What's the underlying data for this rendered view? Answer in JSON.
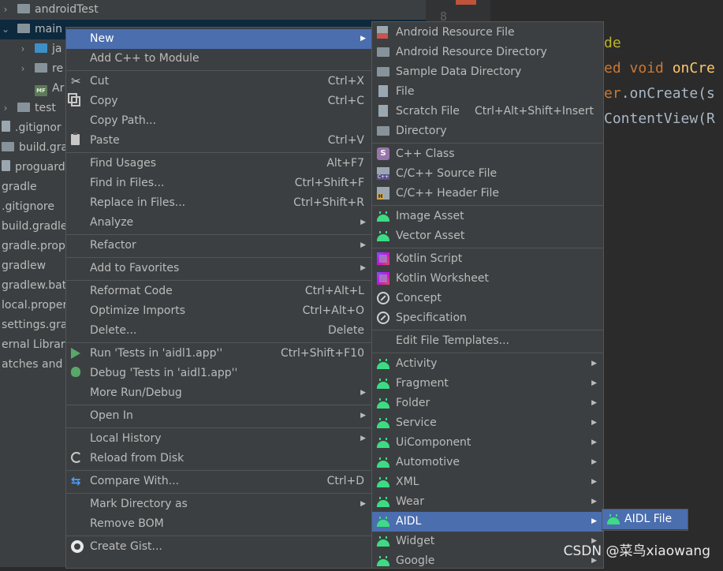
{
  "tree": {
    "items": [
      {
        "label": "androidTest",
        "twisty": "›",
        "icon": "folder-grey",
        "indent": 0
      },
      {
        "label": "main",
        "twisty": "⌄",
        "icon": "folder-grey",
        "indent": 0,
        "selected": true
      },
      {
        "label": "ja",
        "twisty": "›",
        "icon": "folder-blue",
        "indent": 1
      },
      {
        "label": "re",
        "twisty": "›",
        "icon": "folder-grey",
        "indent": 1
      },
      {
        "label": "Ar",
        "twisty": "",
        "icon": "manifest",
        "indent": 1
      },
      {
        "label": "test",
        "twisty": "›",
        "icon": "folder-grey",
        "indent": 0
      },
      {
        "label": ".gitignor",
        "twisty": "",
        "icon": "file",
        "indent": -1
      },
      {
        "label": "build.gra",
        "twisty": "",
        "icon": "gradle",
        "indent": -1
      },
      {
        "label": "proguard",
        "twisty": "",
        "icon": "file",
        "indent": -1
      },
      {
        "label": "gradle",
        "twisty": "",
        "icon": "",
        "indent": -2
      },
      {
        "label": ".gitignore",
        "twisty": "",
        "icon": "",
        "indent": -2
      },
      {
        "label": "build.gradle",
        "twisty": "",
        "icon": "",
        "indent": -2
      },
      {
        "label": "gradle.prope",
        "twisty": "",
        "icon": "",
        "indent": -2
      },
      {
        "label": "gradlew",
        "twisty": "",
        "icon": "",
        "indent": -2
      },
      {
        "label": "gradlew.bat",
        "twisty": "",
        "icon": "",
        "indent": -2
      },
      {
        "label": "local.proper",
        "twisty": "",
        "icon": "",
        "indent": -2
      },
      {
        "label": "settings.grac",
        "twisty": "",
        "icon": "",
        "indent": -2
      },
      {
        "label": "ernal Librarie",
        "twisty": "",
        "icon": "",
        "indent": -2
      },
      {
        "label": "atches and C",
        "twisty": "",
        "icon": "",
        "indent": -2
      }
    ]
  },
  "editor": {
    "gutter_number": "8",
    "lines": [
      {
        "parts": [
          {
            "t": "de",
            "c": "ann"
          }
        ]
      },
      {
        "parts": [
          {
            "t": "ed ",
            "c": "kw"
          },
          {
            "t": "void ",
            "c": "kw"
          },
          {
            "t": "onCre",
            "c": "fn"
          }
        ]
      },
      {
        "parts": [
          {
            "t": "er",
            "c": "kw"
          },
          {
            "t": ".onCreate(s",
            "c": "plain"
          }
        ]
      },
      {
        "parts": [
          {
            "t": "ContentView(R",
            "c": "plain"
          }
        ]
      }
    ]
  },
  "context_menu": {
    "items": [
      {
        "label": "New",
        "shortcut": "",
        "submenu": true,
        "icon": "",
        "highlight": true
      },
      {
        "label": "Add C++ to Module",
        "shortcut": "",
        "submenu": false,
        "icon": ""
      },
      {
        "sep": true
      },
      {
        "label": "Cut",
        "shortcut": "Ctrl+X",
        "icon": "scissors"
      },
      {
        "label": "Copy",
        "shortcut": "Ctrl+C",
        "icon": "copy"
      },
      {
        "label": "Copy Path...",
        "shortcut": "",
        "icon": ""
      },
      {
        "label": "Paste",
        "shortcut": "Ctrl+V",
        "icon": "paste"
      },
      {
        "sep": true
      },
      {
        "label": "Find Usages",
        "shortcut": "Alt+F7",
        "icon": ""
      },
      {
        "label": "Find in Files...",
        "shortcut": "Ctrl+Shift+F",
        "icon": ""
      },
      {
        "label": "Replace in Files...",
        "shortcut": "Ctrl+Shift+R",
        "icon": ""
      },
      {
        "label": "Analyze",
        "shortcut": "",
        "submenu": true,
        "icon": ""
      },
      {
        "sep": true
      },
      {
        "label": "Refactor",
        "shortcut": "",
        "submenu": true,
        "icon": ""
      },
      {
        "sep": true
      },
      {
        "label": "Add to Favorites",
        "shortcut": "",
        "submenu": true,
        "icon": ""
      },
      {
        "sep": true
      },
      {
        "label": "Reformat Code",
        "shortcut": "Ctrl+Alt+L",
        "icon": ""
      },
      {
        "label": "Optimize Imports",
        "shortcut": "Ctrl+Alt+O",
        "icon": ""
      },
      {
        "label": "Delete...",
        "shortcut": "Delete",
        "icon": ""
      },
      {
        "sep": true
      },
      {
        "label": "Run 'Tests in 'aidl1.app''",
        "shortcut": "Ctrl+Shift+F10",
        "icon": "run"
      },
      {
        "label": "Debug 'Tests in 'aidl1.app''",
        "shortcut": "",
        "icon": "debug"
      },
      {
        "label": "More Run/Debug",
        "shortcut": "",
        "submenu": true,
        "icon": ""
      },
      {
        "sep": true
      },
      {
        "label": "Open In",
        "shortcut": "",
        "submenu": true,
        "icon": ""
      },
      {
        "sep": true
      },
      {
        "label": "Local History",
        "shortcut": "",
        "submenu": true,
        "icon": ""
      },
      {
        "label": "Reload from Disk",
        "shortcut": "",
        "icon": "reload"
      },
      {
        "sep": true
      },
      {
        "label": "Compare With...",
        "shortcut": "Ctrl+D",
        "icon": "compare"
      },
      {
        "sep": true
      },
      {
        "label": "Mark Directory as",
        "shortcut": "",
        "submenu": true,
        "icon": ""
      },
      {
        "label": "Remove BOM",
        "shortcut": "",
        "icon": ""
      },
      {
        "sep": true
      },
      {
        "label": "Create Gist...",
        "shortcut": "",
        "icon": "github"
      }
    ]
  },
  "new_submenu": {
    "items": [
      {
        "label": "Android Resource File",
        "shortcut": "",
        "icon": "resfile"
      },
      {
        "label": "Android Resource Directory",
        "shortcut": "",
        "icon": "folder"
      },
      {
        "label": "Sample Data Directory",
        "shortcut": "",
        "icon": "folder"
      },
      {
        "label": "File",
        "shortcut": "",
        "icon": "file"
      },
      {
        "label": "Scratch File",
        "shortcut": "Ctrl+Alt+Shift+Insert",
        "icon": "file"
      },
      {
        "label": "Directory",
        "shortcut": "",
        "icon": "folder"
      },
      {
        "sep": true
      },
      {
        "label": "C++ Class",
        "shortcut": "",
        "icon": "class"
      },
      {
        "label": "C/C++ Source File",
        "shortcut": "",
        "icon": "cpp"
      },
      {
        "label": "C/C++ Header File",
        "shortcut": "",
        "icon": "h"
      },
      {
        "sep": true
      },
      {
        "label": "Image Asset",
        "shortcut": "",
        "icon": "android"
      },
      {
        "label": "Vector Asset",
        "shortcut": "",
        "icon": "android"
      },
      {
        "sep": true
      },
      {
        "label": "Kotlin Script",
        "shortcut": "",
        "icon": "kotlin"
      },
      {
        "label": "Kotlin Worksheet",
        "shortcut": "",
        "icon": "kotlin"
      },
      {
        "label": "Concept",
        "shortcut": "",
        "icon": "concept"
      },
      {
        "label": "Specification",
        "shortcut": "",
        "icon": "concept"
      },
      {
        "sep": true
      },
      {
        "label": "Edit File Templates...",
        "shortcut": "",
        "icon": ""
      },
      {
        "sep": true
      },
      {
        "label": "Activity",
        "submenu": true,
        "icon": "android"
      },
      {
        "label": "Fragment",
        "submenu": true,
        "icon": "android"
      },
      {
        "label": "Folder",
        "submenu": true,
        "icon": "android"
      },
      {
        "label": "Service",
        "submenu": true,
        "icon": "android"
      },
      {
        "label": "UiComponent",
        "submenu": true,
        "icon": "android"
      },
      {
        "label": "Automotive",
        "submenu": true,
        "icon": "android"
      },
      {
        "label": "XML",
        "submenu": true,
        "icon": "android"
      },
      {
        "label": "Wear",
        "submenu": true,
        "icon": "android"
      },
      {
        "label": "AIDL",
        "submenu": true,
        "icon": "android",
        "highlight": true
      },
      {
        "label": "Widget",
        "submenu": true,
        "icon": "android"
      },
      {
        "label": "Google",
        "submenu": true,
        "icon": "android"
      }
    ]
  },
  "aidl_submenu": {
    "items": [
      {
        "label": "AIDL File",
        "icon": "aidl",
        "highlight": true
      }
    ]
  },
  "watermark": "CSDN @菜鸟xiaowang",
  "colors": {
    "highlight": "#4b6eaf",
    "menu_bg": "#3c3f41",
    "android_green": "#3ddc84"
  }
}
